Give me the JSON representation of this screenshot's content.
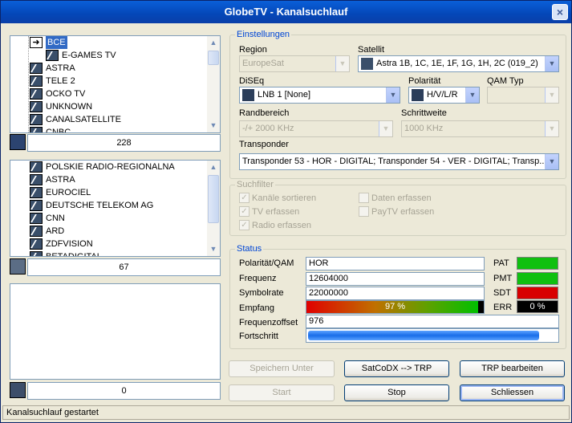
{
  "window": {
    "title": "GlobeTV - Kanalsuchlauf",
    "close_glyph": "×"
  },
  "list1": {
    "items": [
      "BCE",
      "E-GAMES TV",
      "ASTRA",
      "TELE 2",
      "OCKO TV",
      "UNKNOWN",
      "CANALSATELLITE",
      "CNBC"
    ],
    "selected": "BCE",
    "count": "228"
  },
  "list2": {
    "items": [
      "POLSKIE RADIO-REGIONALNA",
      "ASTRA",
      "EUROCIEL",
      "DEUTSCHE TELEKOM AG",
      "CNN",
      "ARD",
      "ZDFVISION",
      "BETADIGITAL"
    ],
    "count": "67"
  },
  "list3": {
    "count": "0"
  },
  "settings": {
    "legend": "Einstellungen",
    "region_label": "Region",
    "region_value": "EuropeSat",
    "satellit_label": "Satellit",
    "satellit_value": "Astra 1B, 1C, 1E, 1F, 1G, 1H, 2C (019_2)",
    "diseqc_label": "DiSEq",
    "diseqc_value": "LNB 1 [None]",
    "polaritaet_label": "Polarität",
    "polaritaet_value": "H/V/L/R",
    "qam_label": "QAM Typ",
    "qam_value": "",
    "randbereich_label": "Randbereich",
    "randbereich_value": "-/+  2000 KHz",
    "schrittweite_label": "Schrittweite",
    "schrittweite_value": "1000 KHz",
    "transponder_label": "Transponder",
    "transponder_value": "Transponder 53 - HOR - DIGITAL; Transponder 54 - VER - DIGITAL; Transp..."
  },
  "filter": {
    "legend": "Suchfilter",
    "sort": "Kanäle sortieren",
    "tv": "TV erfassen",
    "radio": "Radio erfassen",
    "daten": "Daten erfassen",
    "paytv": "PayTV erfassen",
    "check_glyph": "✓"
  },
  "status": {
    "legend": "Status",
    "pol_label": "Polarität/QAM",
    "pol_value": "HOR",
    "freq_label": "Frequenz",
    "freq_value": "12604000",
    "sym_label": "Symbolrate",
    "sym_value": "22000000",
    "empfang_label": "Empfang",
    "empfang_value": "97 %",
    "empfang_fraction": 0.97,
    "offset_label": "Frequenzoffset",
    "offset_value": "976",
    "fortschritt_label": "Fortschritt",
    "fortschritt_fraction": 0.93,
    "pat_label": "PAT",
    "pmt_label": "PMT",
    "sdt_label": "SDT",
    "err_label": "ERR",
    "err_value": "0 %",
    "colors": {
      "ok": "#10c010",
      "bad": "#d80000",
      "err_bg": "#000000"
    }
  },
  "buttons": {
    "speichern": "Speichern Unter",
    "satcodx": "SatCoDX --> TRP",
    "trp_bearbeiten": "TRP bearbeiten",
    "start": "Start",
    "stop": "Stop",
    "schliessen": "Schliessen"
  },
  "statusbar": {
    "text": "Kanalsuchlauf gestartet"
  }
}
